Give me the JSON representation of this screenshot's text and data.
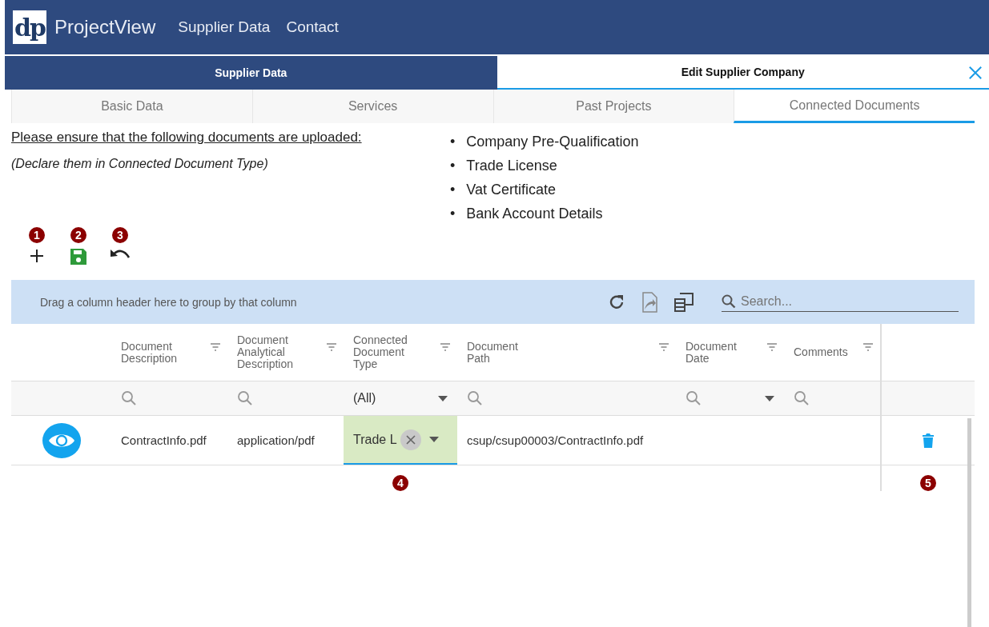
{
  "app": {
    "logo_text": "dp",
    "name": "ProjectView",
    "nav": [
      "Supplier Data",
      "Contact"
    ]
  },
  "panel_tabs": [
    {
      "label": "Supplier Data",
      "selected": false
    },
    {
      "label": "Edit Supplier Company",
      "selected": true
    }
  ],
  "sub_tabs": [
    {
      "label": "Basic Data",
      "selected": false
    },
    {
      "label": "Services",
      "selected": false
    },
    {
      "label": "Past Projects",
      "selected": false
    },
    {
      "label": "Connected Documents",
      "selected": true
    }
  ],
  "requirements": {
    "intro": "Please ensure that the following documents are uploaded:",
    "note": "(Declare them in Connected Document Type)",
    "marker": "•",
    "items": [
      "Company Pre-Qualification",
      "Trade License",
      "Vat Certificate",
      "Bank Account Details"
    ]
  },
  "toolbar": [
    {
      "kind": "add",
      "callout": "1"
    },
    {
      "kind": "save",
      "callout": "2"
    },
    {
      "kind": "undo",
      "callout": "3"
    }
  ],
  "grid": {
    "group_hint": "Drag a column header here to group by that column",
    "search": {
      "placeholder": "Search..."
    },
    "columns": [
      {
        "label": "Document Description",
        "kind": "search"
      },
      {
        "label": "Document Analytical Description",
        "kind": "search"
      },
      {
        "label": "Connected Document Type",
        "kind": "select",
        "filter_value": "(All)"
      },
      {
        "label": "Document Path",
        "kind": "search"
      },
      {
        "label": "Document Date",
        "kind": "date"
      },
      {
        "label": "Comments",
        "kind": "search"
      }
    ],
    "rows": [
      {
        "cells": [
          {
            "text": "ContractInfo.pdf",
            "editing": false
          },
          {
            "text": "application/pdf",
            "editing": false
          },
          {
            "text": "Trade L",
            "editing": true
          },
          {
            "text": "csup/csup00003/ContractInfo.pdf",
            "editing": false
          }
        ]
      }
    ],
    "callouts": [
      {
        "kind": "type_cell",
        "text": "4"
      },
      {
        "kind": "delete",
        "text": "5"
      }
    ]
  }
}
